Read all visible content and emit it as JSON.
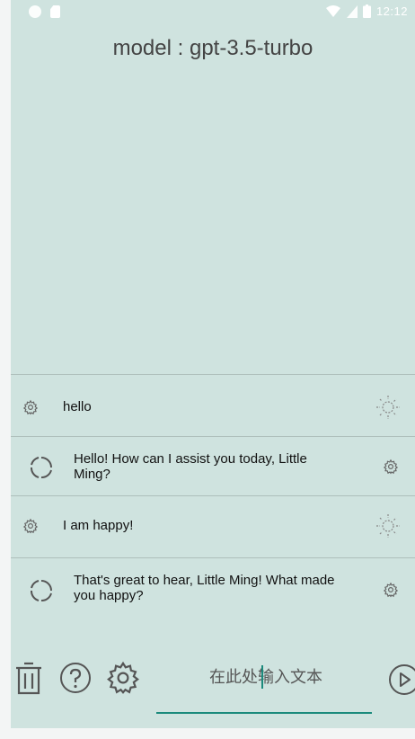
{
  "header": {
    "title": "model : gpt-3.5-turbo"
  },
  "status_bar": {
    "time": "12:12"
  },
  "messages": [
    {
      "role": "user",
      "text": "hello"
    },
    {
      "role": "assistant",
      "text": "Hello! How can I assist you today, Little Ming?"
    },
    {
      "role": "user",
      "text": "I am happy!"
    },
    {
      "role": "assistant",
      "text": "That's great to hear, Little Ming! What made you happy?"
    }
  ],
  "composer": {
    "placeholder": "在此处输入文本"
  },
  "colors": {
    "background": "#cfe3df",
    "accent": "#1b8a7c",
    "divider": "#aebfbb"
  },
  "icons": [
    "trash-icon",
    "help-icon",
    "settings-icon",
    "send-icon",
    "gear-icon",
    "sun-icon",
    "refresh-circle-icon"
  ]
}
